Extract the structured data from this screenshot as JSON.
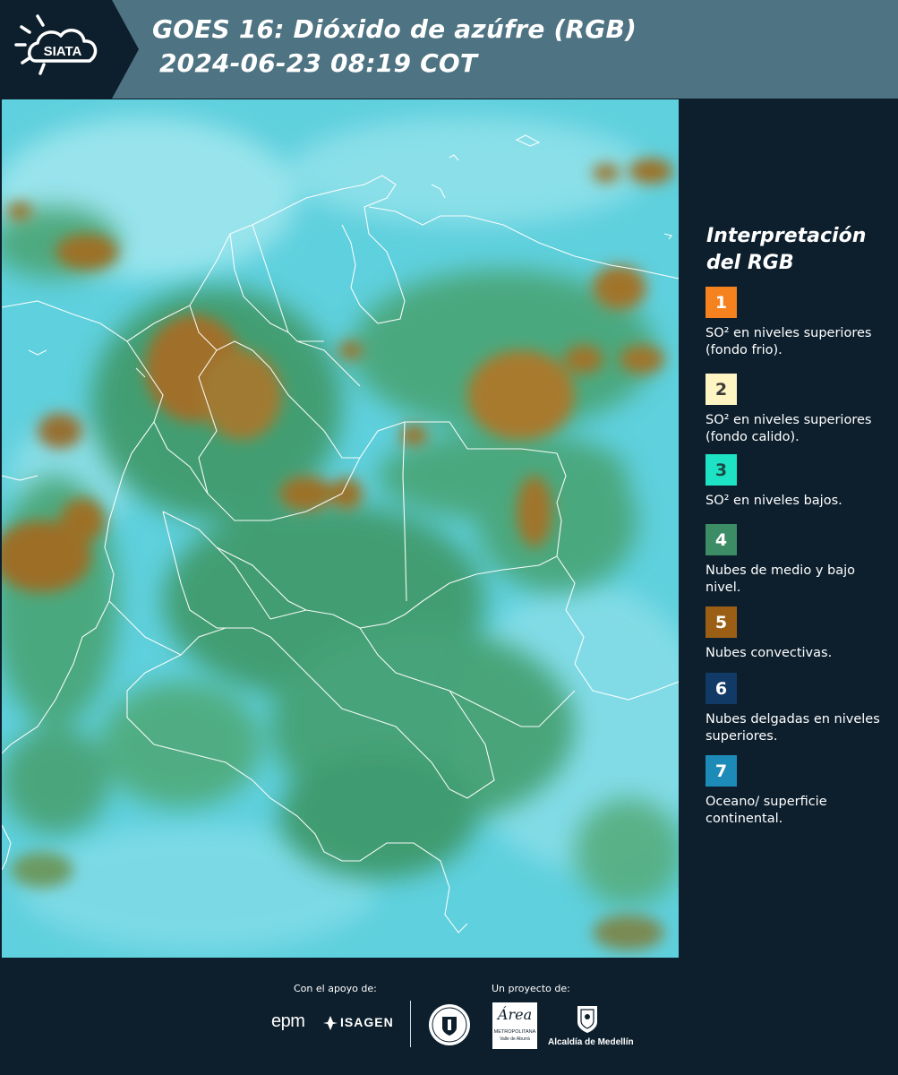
{
  "header": {
    "logo_text": "SIATA",
    "title_line1": "GOES 16: Dióxido de azúfre (RGB)",
    "title_line2": "2024-06-23 08:19 COT"
  },
  "legend": {
    "title": "Interpretación del RGB",
    "items": [
      {
        "number": "1",
        "label": "SO² en niveles superiores (fondo frio).",
        "color": "#f5821f",
        "text_color": "#ffffff"
      },
      {
        "number": "2",
        "label": "SO² en niveles superiores (fondo calido).",
        "color": "#fff5c2",
        "text_color": "#3a3a3a"
      },
      {
        "number": "3",
        "label": "SO² en niveles bajos.",
        "color": "#1de3c4",
        "text_color": "#1a4a44"
      },
      {
        "number": "4",
        "label": "Nubes de medio y bajo nivel.",
        "color": "#3c8c66",
        "text_color": "#ffffff"
      },
      {
        "number": "5",
        "label": "Nubes convectivas.",
        "color": "#9a5f14",
        "text_color": "#ffffff"
      },
      {
        "number": "6",
        "label": "Nubes delgadas en niveles superiores.",
        "color": "#123a66",
        "text_color": "#ffffff"
      },
      {
        "number": "7",
        "label": "Oceano/ superficie continental.",
        "color": "#1c8bb8",
        "text_color": "#ffffff"
      }
    ]
  },
  "footer": {
    "support_label": "Con el apoyo de:",
    "project_label": "Un proyecto de:",
    "sponsor_epm": "epm",
    "sponsor_isagen": "ISAGEN",
    "area_logo_text": "Área",
    "area_subtitle": "METROPOLITANA",
    "area_subtitle2": "Valle de Aburrá",
    "alcaldia": "Alcaldía de Medellín"
  }
}
